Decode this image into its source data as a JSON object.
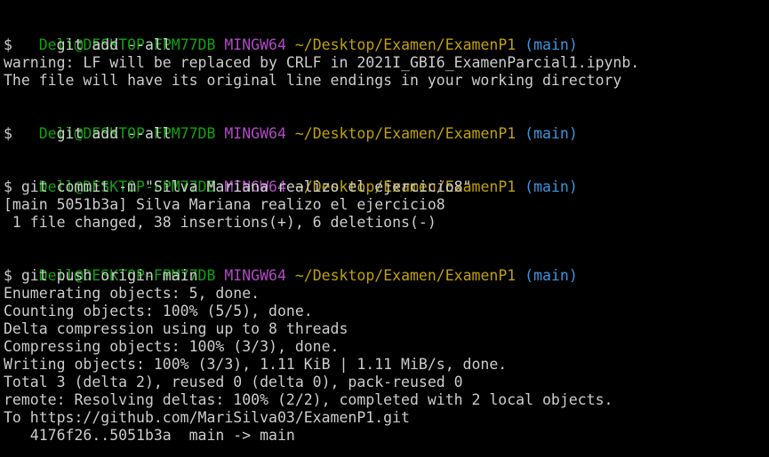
{
  "colors": {
    "background": "#000000",
    "text": "#cccccc",
    "user": "#13a10e",
    "system": "#b148c6",
    "path": "#c1a102",
    "branch": "#3a96dd"
  },
  "blocks": [
    {
      "prompt": {
        "user": "Dell@DESKTOP-FPM77DB",
        "system": "MINGW64",
        "path": "~/Desktop/Examen/ExamenP1",
        "branch": "(main)"
      },
      "command": "$     git add --all",
      "output": [
        "warning: LF will be replaced by CRLF in 2021I_GBI6_ExamenParcial1.ipynb.",
        "The file will have its original line endings in your working directory"
      ]
    },
    {
      "prompt": {
        "user": "Dell@DESKTOP-FPM77DB",
        "system": "MINGW64",
        "path": "~/Desktop/Examen/ExamenP1",
        "branch": "(main)"
      },
      "command": "$     git add --all",
      "output": []
    },
    {
      "prompt": {
        "user": "Dell@DESKTOP-FPM77DB",
        "system": "MINGW64",
        "path": "~/Desktop/Examen/ExamenP1",
        "branch": "(main)"
      },
      "command": "$ git commit -m \"Silva Mariana realizo el ejercicio8\"",
      "output": [
        "[main 5051b3a] Silva Mariana realizo el ejercicio8",
        " 1 file changed, 38 insertions(+), 6 deletions(-)"
      ]
    },
    {
      "prompt": {
        "user": "Dell@DESKTOP-FPM77DB",
        "system": "MINGW64",
        "path": "~/Desktop/Examen/ExamenP1",
        "branch": "(main)"
      },
      "command": "$ git push origin main",
      "output": [
        "Enumerating objects: 5, done.",
        "Counting objects: 100% (5/5), done.",
        "Delta compression using up to 8 threads",
        "Compressing objects: 100% (3/3), done.",
        "Writing objects: 100% (3/3), 1.11 KiB | 1.11 MiB/s, done.",
        "Total 3 (delta 2), reused 0 (delta 0), pack-reused 0",
        "remote: Resolving deltas: 100% (2/2), completed with 2 local objects.",
        "To https://github.com/MariSilva03/ExamenP1.git",
        "   4176f26..5051b3a  main -> main"
      ]
    }
  ]
}
